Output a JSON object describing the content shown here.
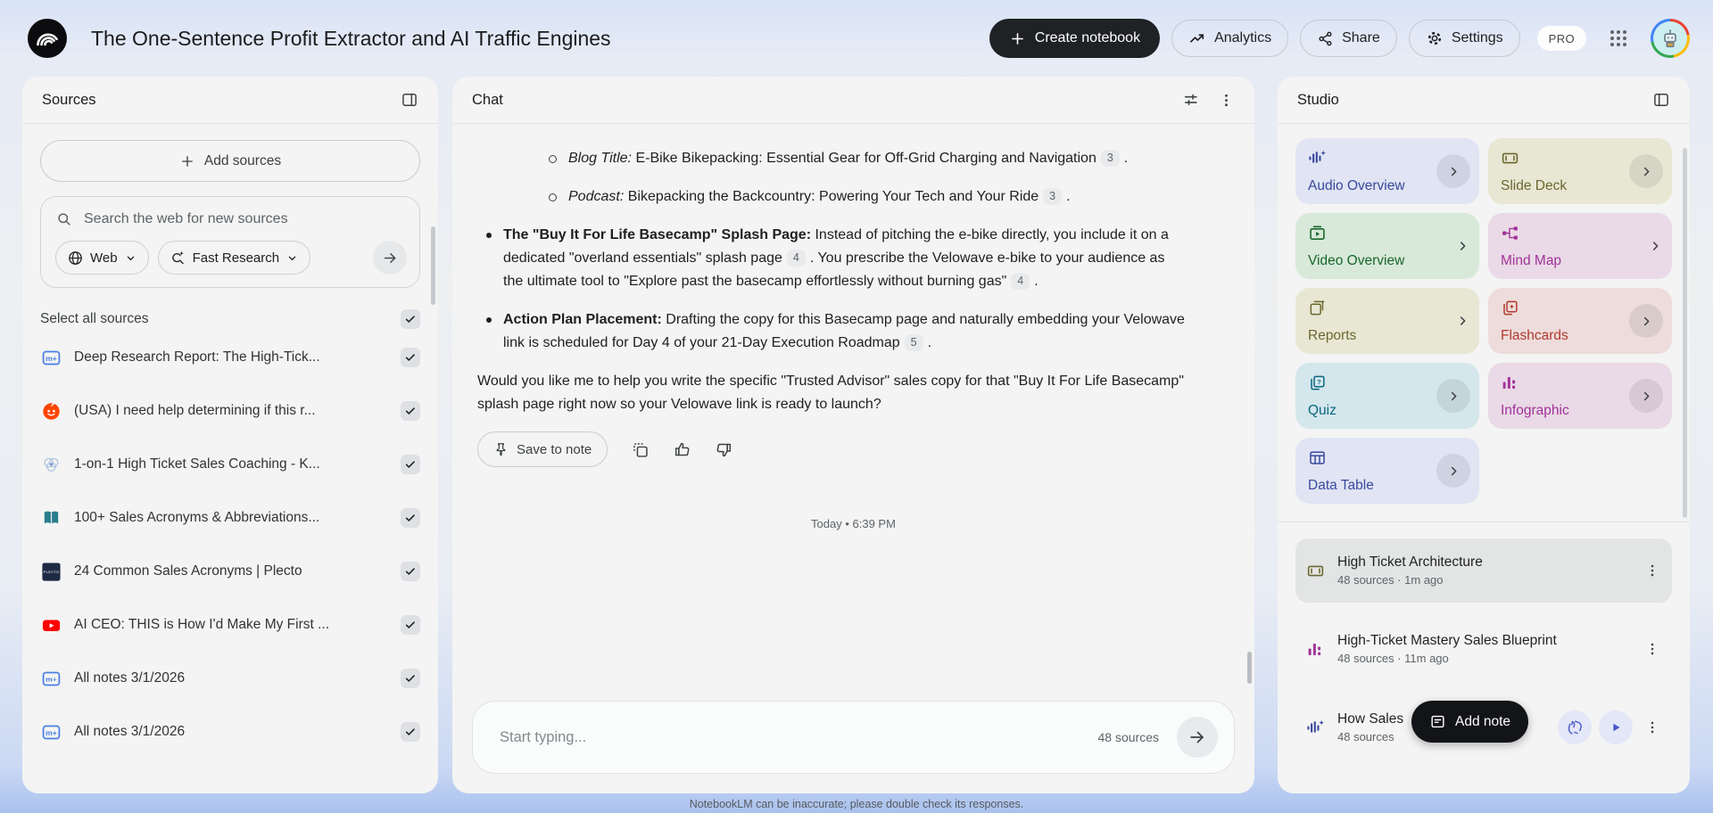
{
  "header": {
    "title": "The One-Sentence Profit Extractor and AI Traffic Engines",
    "create_notebook_label": "Create notebook",
    "analytics_label": "Analytics",
    "share_label": "Share",
    "settings_label": "Settings",
    "pro_badge": "PRO"
  },
  "sources_panel": {
    "title": "Sources",
    "add_sources_label": "Add sources",
    "search_placeholder": "Search the web for new sources",
    "web_filter_label": "Web",
    "research_mode_label": "Fast Research",
    "select_all_label": "Select all sources",
    "sources": [
      {
        "icon": "doc-markdown",
        "title": "Deep Research Report: The High-Tick...",
        "checked": true
      },
      {
        "icon": "reddit",
        "title": "(USA) I need help determining if this r...",
        "checked": true
      },
      {
        "icon": "venn",
        "title": "1-on-1 High Ticket Sales Coaching - K...",
        "checked": true
      },
      {
        "icon": "book",
        "title": "100+ Sales Acronyms & Abbreviations...",
        "checked": true
      },
      {
        "icon": "plecto",
        "title": "24 Common Sales Acronyms | Plecto",
        "checked": true
      },
      {
        "icon": "youtube",
        "title": "AI CEO: THIS is How I'd Make My First ...",
        "checked": true
      },
      {
        "icon": "doc-markdown",
        "title": "All notes 3/1/2026",
        "checked": true
      },
      {
        "icon": "doc-markdown",
        "title": "All notes 3/1/2026",
        "checked": true
      }
    ]
  },
  "chat_panel": {
    "title": "Chat",
    "message_blocks": [
      {
        "type": "sub_bullet",
        "segments": [
          {
            "i": "Blog Title:"
          },
          {
            "t": " E-Bike Bikepacking: Essential Gear for Off-Grid Charging and Navigation"
          },
          {
            "c": "3"
          },
          {
            "t": "."
          }
        ]
      },
      {
        "type": "sub_bullet",
        "segments": [
          {
            "i": "Podcast:"
          },
          {
            "t": " Bikepacking the Backcountry: Powering Your Tech and Your Ride"
          },
          {
            "c": "3"
          },
          {
            "t": "."
          }
        ]
      },
      {
        "type": "bullet",
        "segments": [
          {
            "b": "The \"Buy It For Life Basecamp\" Splash Page:"
          },
          {
            "t": " Instead of pitching the e-bike directly, you include it on a dedicated \"overland essentials\" splash page"
          },
          {
            "c": "4"
          },
          {
            "t": ". You prescribe the Velowave e-bike to your audience as the ultimate tool to \"Explore past the basecamp effortlessly without burning gas\""
          },
          {
            "c": "4"
          },
          {
            "t": "."
          }
        ]
      },
      {
        "type": "bullet",
        "segments": [
          {
            "b": "Action Plan Placement:"
          },
          {
            "t": " Drafting the copy for this Basecamp page and naturally embedding your Velowave link is scheduled for Day 4 of your 21-Day Execution Roadmap"
          },
          {
            "c": "5"
          },
          {
            "t": "."
          }
        ]
      },
      {
        "type": "paragraph",
        "segments": [
          {
            "t": "Would you like me to help you write the specific \"Trusted Advisor\" sales copy for that \"Buy It For Life Basecamp\" splash page right now so your Velowave link is ready to launch?"
          }
        ]
      }
    ],
    "save_to_note_label": "Save to note",
    "timestamp": "Today • 6:39 PM",
    "input_placeholder": "Start typing...",
    "source_count_label": "48 sources",
    "disclaimer": "NotebookLM can be inaccurate; please double check its responses."
  },
  "studio_panel": {
    "title": "Studio",
    "tiles": [
      {
        "id": "audio-overview",
        "label": "Audio Overview",
        "icon": "waveform-sparkle",
        "bg": "#e0e4f3",
        "fg": "#39499c",
        "chevron_circle": true
      },
      {
        "id": "slide-deck",
        "label": "Slide Deck",
        "icon": "slide",
        "bg": "#e8e7d4",
        "fg": "#6a682f",
        "chevron_circle": true
      },
      {
        "id": "video-overview",
        "label": "Video Overview",
        "icon": "video",
        "bg": "#d8e9d9",
        "fg": "#19662b",
        "chevron_circle": false
      },
      {
        "id": "mind-map",
        "label": "Mind Map",
        "icon": "mindmap",
        "bg": "#ead9e6",
        "fg": "#a03399",
        "chevron_circle": false
      },
      {
        "id": "reports",
        "label": "Reports",
        "icon": "report",
        "bg": "#e8e7d4",
        "fg": "#6a682f",
        "chevron_circle": false
      },
      {
        "id": "flashcards",
        "label": "Flashcards",
        "icon": "flashcards",
        "bg": "#eddcdb",
        "fg": "#b2392f",
        "chevron_circle": true
      },
      {
        "id": "quiz",
        "label": "Quiz",
        "icon": "quiz",
        "bg": "#d3e7ec",
        "fg": "#0b6780",
        "chevron_circle": true
      },
      {
        "id": "infographic",
        "label": "Infographic",
        "icon": "barchart",
        "bg": "#ead9e6",
        "fg": "#a03399",
        "chevron_circle": true
      },
      {
        "id": "data-table",
        "label": "Data Table",
        "icon": "table",
        "bg": "#e0e4f3",
        "fg": "#39499c",
        "chevron_circle": true
      }
    ],
    "artifacts": [
      {
        "icon": "slide",
        "fg": "#6a682f",
        "title": "High Ticket Architecture",
        "meta": "48 sources · 1m ago",
        "selected": true,
        "has_actions": false
      },
      {
        "icon": "barchart",
        "fg": "#a03399",
        "title": "High-Ticket Mastery Sales Blueprint",
        "meta": "48 sources · 11m ago",
        "selected": false,
        "has_actions": false
      },
      {
        "icon": "waveform-sparkle",
        "fg": "#39499c",
        "title": "How Sales",
        "meta": "48 sources",
        "selected": false,
        "has_actions": true
      }
    ],
    "add_note_label": "Add note"
  }
}
